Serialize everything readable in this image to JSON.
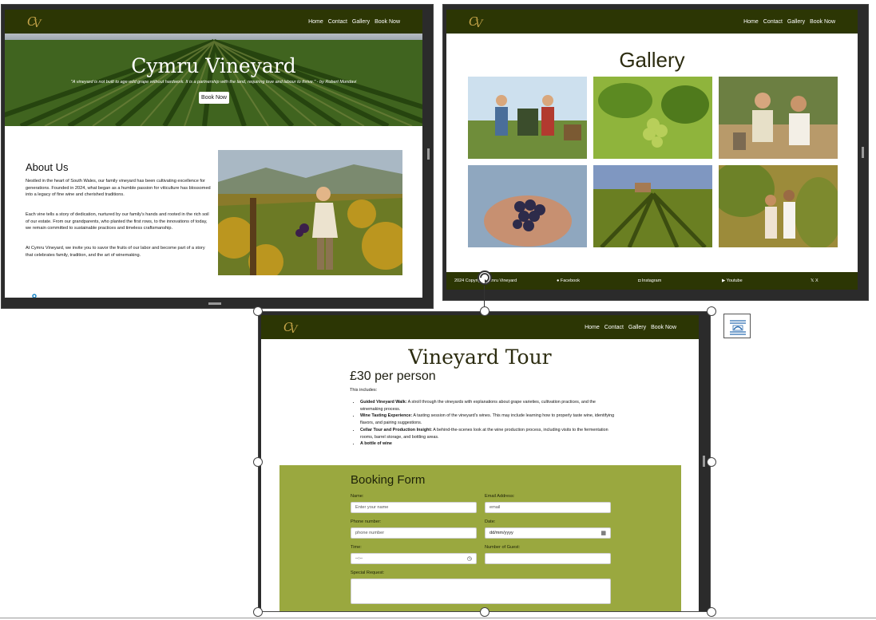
{
  "nav": {
    "items": [
      "Home",
      "Contact",
      "Gallery",
      "Book Now"
    ]
  },
  "home": {
    "hero_title": "Cymru Vineyard",
    "hero_quote": "\"A vineyard is not built to age wild grape without hardwork. It is a partnership with the land, requiring love and labour to thrive.\" - by Robert Mondavi",
    "hero_button": "Book Now",
    "about_title": "About Us",
    "about_p1": "Nestled in the heart of South Wales, our family vineyard has been cultivating excellence for generations. Founded in 2024, what began as a humble passion for viticulture has blossomed into a legacy of fine wine and cherished traditions.",
    "about_p2": "Each vine tells a story of dedication, nurtured by our family's hands and rooted in the rich soil of our estate. From our grandparents, who planted the first rows, to the innovations of today, we remain committed to sustainable practices and timeless craftsmanship.",
    "about_p3": "At Cymru Vineyard, we invite you to savor the fruits of our labor and become part of a story that celebrates family, tradition, and the art of winemaking."
  },
  "gallery": {
    "title": "Gallery",
    "footer": {
      "copyright": "2024 Copyright Cymru Vineyard",
      "facebook": "Facebook",
      "instagram": "Instagram",
      "youtube": "Youtube",
      "x": "X"
    }
  },
  "tour": {
    "title": "Vineyard Tour",
    "price": "£30 per person",
    "includes": "This includes:",
    "items": [
      {
        "name": "Guided Vineyard Walk:",
        "desc": " A stroll through the vineyards with explanations about grape varieties, cultivation practices, and the winemaking process."
      },
      {
        "name": "Wine Tasting Experience:",
        "desc": " A tasting session of the vineyard's wines. This may include learning how to properly taste wine, identifying flavors, and pairing suggestions."
      },
      {
        "name": "Cellar Tour and Production Insight:",
        "desc": " A behind-the-scenes look at the wine production process, including visits to the fermentation rooms, barrel storage, and bottling areas."
      },
      {
        "name": "A bottle of wine",
        "desc": ""
      }
    ],
    "form": {
      "title": "Booking Form",
      "name_label": "Name:",
      "name_placeholder": "Enter your name",
      "email_label": "Email Address:",
      "email_placeholder": "email",
      "phone_label": "Phone number:",
      "phone_placeholder": "phone number",
      "date_label": "Date:",
      "date_value": "dd/mm/yyyy",
      "time_label": "Time:",
      "time_value": "--:--",
      "guests_label": "Number of Guest:",
      "request_label": "Special Request:"
    }
  }
}
